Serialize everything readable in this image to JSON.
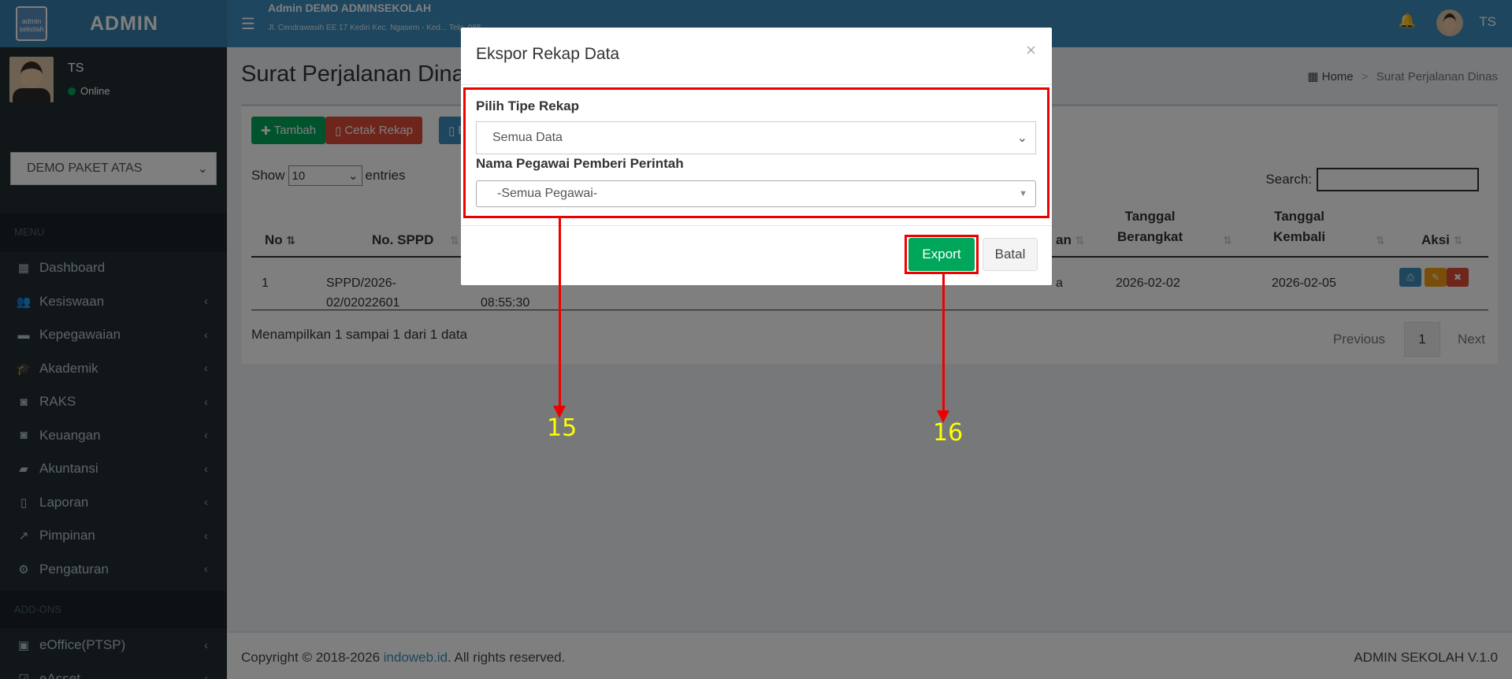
{
  "sidebar": {
    "logo_text": "admin sekolah",
    "brand": "ADMIN",
    "user_name": "TS",
    "user_status": "Online",
    "package_select": "DEMO PAKET ATAS",
    "menu_header": "MENU",
    "items": [
      {
        "label": "Dashboard",
        "icon": "dashboard-icon",
        "glyph": "▦",
        "has_sub": false
      },
      {
        "label": "Kesiswaan",
        "icon": "users-icon",
        "glyph": "👥",
        "has_sub": true
      },
      {
        "label": "Kepegawaian",
        "icon": "briefcase-icon",
        "glyph": "▬",
        "has_sub": true
      },
      {
        "label": "Akademik",
        "icon": "graduation-cap-icon",
        "glyph": "🎓",
        "has_sub": true
      },
      {
        "label": "RAKS",
        "icon": "money-icon",
        "glyph": "◙",
        "has_sub": true
      },
      {
        "label": "Keuangan",
        "icon": "money-icon",
        "glyph": "◙",
        "has_sub": true
      },
      {
        "label": "Akuntansi",
        "icon": "ticket-icon",
        "glyph": "▰",
        "has_sub": true
      },
      {
        "label": "Laporan",
        "icon": "file-icon",
        "glyph": "▯",
        "has_sub": true
      },
      {
        "label": "Pimpinan",
        "icon": "line-chart-icon",
        "glyph": "↗",
        "has_sub": true
      },
      {
        "label": "Pengaturan",
        "icon": "gear-icon",
        "glyph": "⚙",
        "has_sub": true
      }
    ],
    "addons_header": "ADD-ONS",
    "addon_items": [
      {
        "label": "eOffice(PTSP)",
        "icon": "archive-icon",
        "glyph": "▣"
      },
      {
        "label": "eAsset",
        "icon": "checkbox-icon",
        "glyph": "☑"
      }
    ]
  },
  "topbar": {
    "school_name": "Admin DEMO ADMINSEKOLAH",
    "school_address": "Jl. Cendrawasih EE 17 Kediri Kec. Ngasem - Ked... Telp. 085... ",
    "user": "TS"
  },
  "page": {
    "title": "Surat Perjalanan Dinas",
    "breadcrumb_home": "Home",
    "breadcrumb_current": "Surat Perjalanan Dinas"
  },
  "toolbar": {
    "add_label": "Tambah",
    "print_label": "Cetak Rekap",
    "export_label": "Ex"
  },
  "table": {
    "show_label": "Show",
    "entries_value": "10",
    "entries_label": "entries",
    "search_label": "Search:",
    "headers": {
      "no": "No",
      "sppd": "No. SPPD",
      "an": "an",
      "tgl_berangkat_1": "Tanggal",
      "tgl_berangkat_2": "Berangkat",
      "tgl_kembali_1": "Tanggal",
      "tgl_kembali_2": "Kembali",
      "aksi": "Aksi"
    },
    "row": {
      "no": "1",
      "sppd_1": "SPPD/2026-",
      "sppd_2": "02/02022601",
      "time": "08:55:30",
      "an_partial": "a",
      "berangkat": "2026-02-02",
      "kembali": "2026-02-05"
    },
    "info": "Menampilkan 1 sampai 1 dari 1 data",
    "pager": {
      "previous": "Previous",
      "page": "1",
      "next": "Next"
    }
  },
  "footer": {
    "copyright_pre": "Copyright © 2018-2026 ",
    "link": "indoweb.id",
    "copyright_post": ". All rights reserved.",
    "version": "ADMIN SEKOLAH V.1.0"
  },
  "modal": {
    "title": "Ekspor Rekap Data",
    "close": "×",
    "type_label": "Pilih Tipe Rekap",
    "type_value": "Semua Data",
    "employee_label": "Nama Pegawai Pemberi Perintah",
    "employee_value": "-Semua Pegawai-",
    "export_label": "Export",
    "cancel_label": "Batal"
  },
  "annotations": {
    "step_a": "15",
    "step_b": "16"
  },
  "colors": {
    "primary": "#3c8dbc",
    "success": "#00a65a",
    "danger": "#dd4b39",
    "sidebar": "#222d32",
    "highlight": "#ee0000",
    "annotation_text": "#ffff00"
  }
}
